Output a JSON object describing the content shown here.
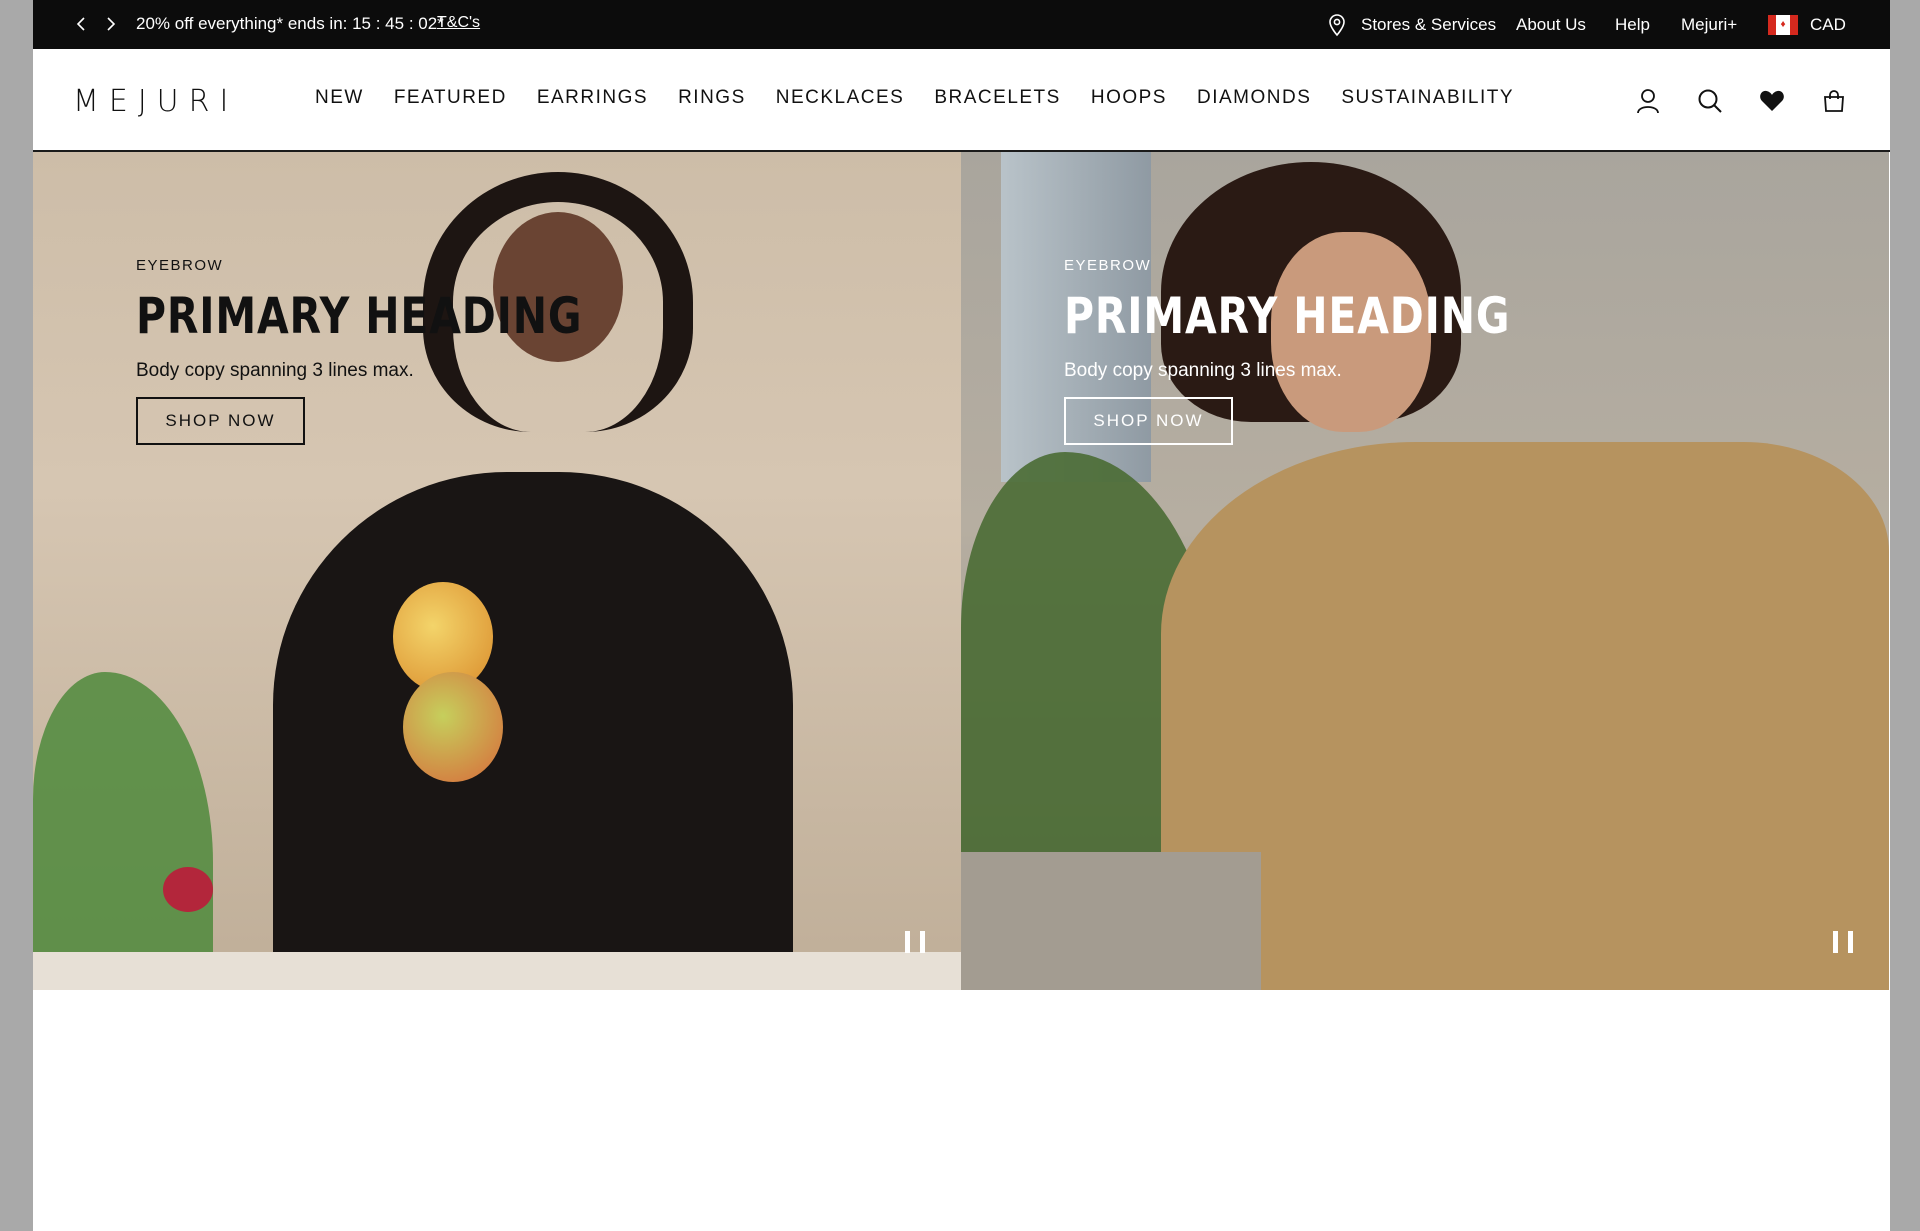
{
  "topbar": {
    "promo": "20% off everything* ends in: 15 : 45 : 02*",
    "tc_link": "T&C's",
    "stores": "Stores & Services",
    "about": "About Us",
    "help": "Help",
    "mejuri_plus": "Mejuri+",
    "currency": "CAD"
  },
  "header": {
    "logo": "MEJURI",
    "nav": [
      "NEW",
      "FEATURED",
      "EARRINGS",
      "RINGS",
      "NECKLACES",
      "BRACELETS",
      "HOOPS",
      "DIAMONDS",
      "SUSTAINABILITY"
    ]
  },
  "hero": [
    {
      "eyebrow": "EYEBROW",
      "heading": "PRIMARY HEADING",
      "body": "Body copy spanning 3 lines max.",
      "cta": "SHOP NOW",
      "text_color": "#111111"
    },
    {
      "eyebrow": "EYEBROW",
      "heading": "PRIMARY HEADING",
      "body": "Body copy spanning 3 lines max.",
      "cta": "SHOP NOW",
      "text_color": "#ffffff"
    }
  ],
  "icons": [
    "chevron-left-icon",
    "chevron-right-icon",
    "location-pin-icon",
    "canada-flag-icon",
    "account-icon",
    "search-icon",
    "heart-icon",
    "shopping-bag-icon",
    "pause-icon"
  ]
}
